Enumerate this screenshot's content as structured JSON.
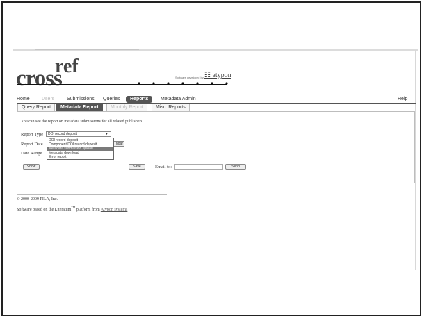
{
  "logo": {
    "cross": "cross",
    "ref": "ref"
  },
  "atypon": {
    "developed_by": "Software developed by",
    "name": "atypon"
  },
  "main_nav": {
    "tabs": [
      {
        "label": "Home",
        "state": "normal"
      },
      {
        "label": "Users",
        "state": "disabled"
      },
      {
        "label": "Submissions",
        "state": "normal"
      },
      {
        "label": "Queries",
        "state": "normal"
      },
      {
        "label": "Reports",
        "state": "active"
      },
      {
        "label": "Metadata Admin",
        "state": "normal"
      }
    ],
    "help": "Help"
  },
  "sub_nav": {
    "tabs": [
      {
        "label": "Query Report",
        "state": "normal"
      },
      {
        "label": "Metadata Report",
        "state": "active"
      },
      {
        "label": "Monthly Report",
        "state": "disabled"
      },
      {
        "label": "Misc. Reports",
        "state": "normal"
      }
    ]
  },
  "form": {
    "intro": "You can see the report on metadata submissions for all related publishers.",
    "report_type_label": "Report Type",
    "report_type_value": "DOI record deposit",
    "report_type_options": [
      "DOI record deposit",
      "Component DOI record deposit",
      "Metadata submission upload",
      "Metadata download",
      "Error report"
    ],
    "highlighted_option_index": 2,
    "report_date_label": "Report Date",
    "calendar_button": "ndar",
    "date_range_label": "Date Range",
    "show_button": "Show",
    "save_button": "Save",
    "email_label": "Email to:",
    "email_value": "",
    "send_button": "Send"
  },
  "footer": {
    "copyright": "© 2000-2009 PILA, Inc.",
    "based_on": "Software based on the Literatum",
    "tm": "TM",
    "platform_from": " platform from ",
    "atypon_systems": "Atypon systems"
  },
  "colors": {
    "active_tab_bg": "#555555",
    "highlight_option_bg": "#7a7a7a",
    "border": "#bdbdbd"
  }
}
